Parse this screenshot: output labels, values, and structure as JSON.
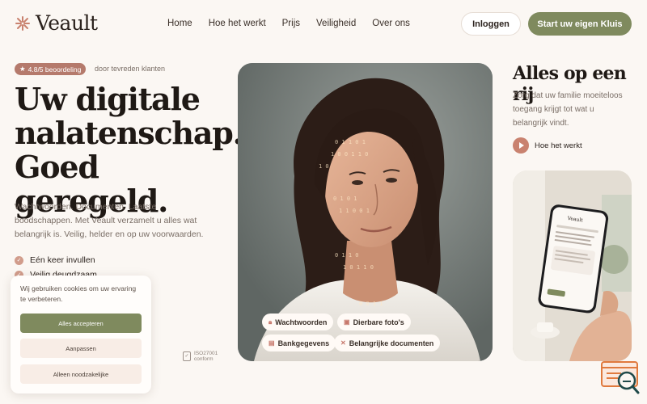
{
  "brand": {
    "name": "Veault",
    "accent": "#7f8a5e",
    "rose": "#c9826f"
  },
  "nav": {
    "items": [
      "Home",
      "Hoe het werkt",
      "Prijs",
      "Veiligheid",
      "Over ons"
    ]
  },
  "header": {
    "login_label": "Inloggen",
    "start_label": "Start uw eigen Kluis"
  },
  "hero": {
    "rating": "4.8/5 beoordeling",
    "rating_sub": "door tevreden klanten",
    "title_lines": [
      "Uw digitale",
      "nalatenschap.",
      "Goed geregeld."
    ],
    "description": "Wachtwoorden. Documenten. Laatste boodschappen. Met Veault verzamelt u alles wat belangrijk is. Veilig, helder en op uw voorwaarden.",
    "features": [
      "Eén keer invullen",
      "Veilig deugdzaam"
    ]
  },
  "trust": [
    {
      "line1": "",
      "line2": "",
      "icon": "shield-icon"
    },
    {
      "line1": "ISO27001",
      "line2": "conform",
      "icon": "certificate-icon"
    }
  ],
  "cookie": {
    "text": "Wij gebruiken cookies om uw ervaring te verbeteren.",
    "accept": "Alles accepteren",
    "adjust": "Aanpassen",
    "essential": "Alleen noodzakelijke"
  },
  "photo_pills": [
    {
      "label": "Wachtwoorden",
      "icon": "lock-icon"
    },
    {
      "label": "Dierbare foto's",
      "icon": "image-icon"
    },
    {
      "label": "Bankgegevens",
      "icon": "bank-icon"
    },
    {
      "label": "Belangrijke documenten",
      "icon": "document-icon"
    }
  ],
  "right": {
    "title": "Alles op een rij",
    "description": "Zorg dat uw familie moeiteloos toegang krijgt tot wat u belangrijk vindt.",
    "play_label": "Hoe het werkt"
  },
  "phone": {
    "brand": "Veault"
  }
}
